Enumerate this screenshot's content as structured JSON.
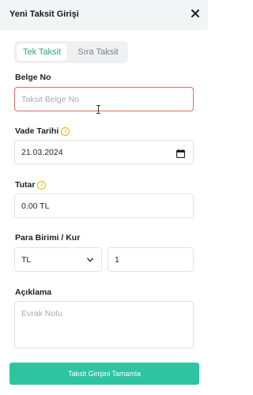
{
  "header": {
    "title": "Yeni Taksit Girişi"
  },
  "tabs": [
    {
      "label": "Tek Taksit",
      "active": true
    },
    {
      "label": "Sıra Taksit",
      "active": false
    }
  ],
  "belge_no": {
    "label": "Belge No",
    "placeholder": "Taksit Belge No",
    "value": ""
  },
  "vade_tarihi": {
    "label": "Vade Tarihi",
    "value": "21.03.2024"
  },
  "tutar": {
    "label": "Tutar",
    "value": "0.00 TL"
  },
  "para_birimi": {
    "label": "Para Birimi / Kur",
    "currency": "TL",
    "rate": "1"
  },
  "aciklama": {
    "label": "Açıklama",
    "placeholder": "Evrak Notu"
  },
  "submit": {
    "label": "Taksit Girişini Tamamla"
  },
  "colors": {
    "accent": "#2ec4a1",
    "active_tab_text": "#1fa88a",
    "error_border": "#e06a6a",
    "info_icon": "#e8b900"
  },
  "icons": [
    "close-icon",
    "info-icon",
    "calendar-icon",
    "chevron-down-icon"
  ]
}
